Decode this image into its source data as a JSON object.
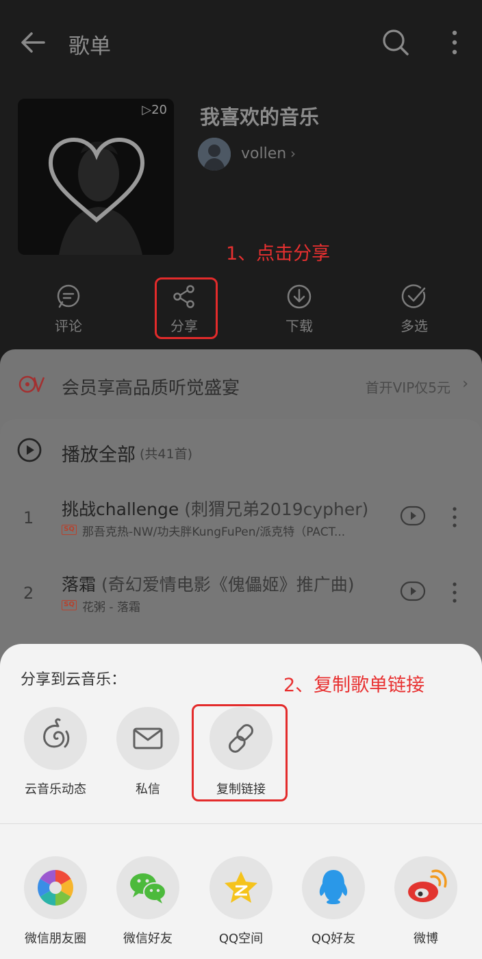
{
  "header": {
    "title": "歌单"
  },
  "playlist": {
    "play_count": "▷20",
    "name": "我喜欢的音乐",
    "creator": "vollen"
  },
  "annotations": {
    "step1": "1、点击分享",
    "step2": "2、复制歌单链接"
  },
  "actions": [
    {
      "label": "评论",
      "icon": "comment-icon"
    },
    {
      "label": "分享",
      "icon": "share-icon"
    },
    {
      "label": "下载",
      "icon": "download-icon"
    },
    {
      "label": "多选",
      "icon": "check-circle-icon"
    }
  ],
  "vip": {
    "text": "会员享高品质听觉盛宴",
    "offer": "首开VIP仅5元"
  },
  "song_list": {
    "play_all": "播放全部",
    "count": "(共41首)",
    "songs": [
      {
        "index": "1",
        "title": "挑战challenge",
        "alias": " (刺猬兄弟2019cypher)",
        "quality": "SQ",
        "artist": "那吾克热-NW/功夫胖KungFuPen/派克特（PACT..."
      },
      {
        "index": "2",
        "title": "落霜",
        "alias": " (奇幻爱情电影《傀儡姬》推广曲)",
        "quality": "SQ",
        "artist": "花粥 - 落霜"
      }
    ]
  },
  "share_sheet": {
    "heading": "分享到云音乐：",
    "internal": [
      {
        "label": "云音乐动态",
        "icon": "cloud-music-moments-icon"
      },
      {
        "label": "私信",
        "icon": "mail-icon"
      },
      {
        "label": "复制链接",
        "icon": "link-icon"
      }
    ],
    "external": [
      {
        "label": "微信朋友圈",
        "icon": "wechat-moments-icon"
      },
      {
        "label": "微信好友",
        "icon": "wechat-icon"
      },
      {
        "label": "QQ空间",
        "icon": "qzone-icon"
      },
      {
        "label": "QQ好友",
        "icon": "qq-icon"
      },
      {
        "label": "微博",
        "icon": "weibo-icon"
      }
    ]
  },
  "colors": {
    "annotation": "#e83030",
    "sheet_bg": "#f3f3f3",
    "overlay_gray": "#777777"
  }
}
